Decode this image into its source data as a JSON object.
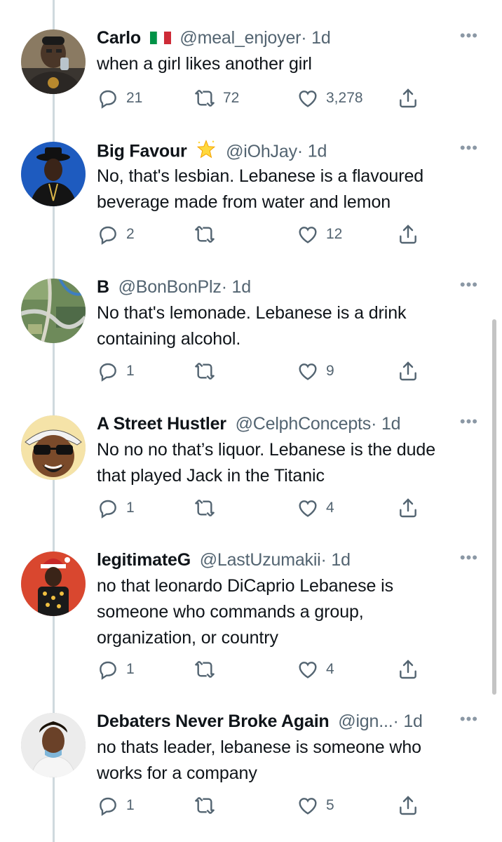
{
  "replies": [
    {
      "name": "Carlo",
      "badge": "italy-flag",
      "handle": "@meal_enjoyer",
      "time": "· 1d",
      "text": [
        "when a girl likes another girl"
      ],
      "replies": "21",
      "retweets": "72",
      "likes": "3,278",
      "avatar_color": "#6b5a45"
    },
    {
      "name": "Big Favour",
      "badge": "star-icon",
      "handle": "@iOhJay",
      "time": "· 1d",
      "text": [
        "No, that's lesbian. Lebanese is a flavoured",
        "beverage made from water and lemon"
      ],
      "replies": "2",
      "retweets": "",
      "likes": "12",
      "avatar_color": "#1e5bbf"
    },
    {
      "name": "B",
      "badge": "",
      "handle": "@BonBonPlz",
      "time": "· 1d",
      "text": [
        "No that's lemonade. Lebanese is a drink",
        "containing alcohol."
      ],
      "replies": "1",
      "retweets": "",
      "likes": "9",
      "avatar_color": "#5c7a66"
    },
    {
      "name": "A Street Hustler",
      "badge": "",
      "handle": "@CelphConcepts",
      "time": "· 1d",
      "text": [
        "No no no that’s liquor. Lebanese is the dude",
        "that played Jack in the Titanic"
      ],
      "replies": "1",
      "retweets": "",
      "likes": "4",
      "avatar_color": "#f5e3a8"
    },
    {
      "name": "legitimateG",
      "badge": "",
      "handle": "@LastUzumakii",
      "time": "· 1d",
      "text": [
        "no that leonardo DiCaprio Lebanese  is",
        "someone  who  commands a group,",
        "organization, or country"
      ],
      "replies": "1",
      "retweets": "",
      "likes": "4",
      "avatar_color": "#d9472f"
    },
    {
      "name": "Debaters Never Broke Again",
      "badge": "",
      "handle": "@ign...",
      "time": "· 1d",
      "text": [
        "no thats leader, lebanese is someone who",
        "works for a company"
      ],
      "replies": "1",
      "retweets": "",
      "likes": "5",
      "avatar_color": "#e6e6e6"
    }
  ],
  "colors": {
    "text": "#0f1419",
    "muted": "#536471",
    "thread_line": "#cfd9de",
    "background": "#ffffff"
  }
}
